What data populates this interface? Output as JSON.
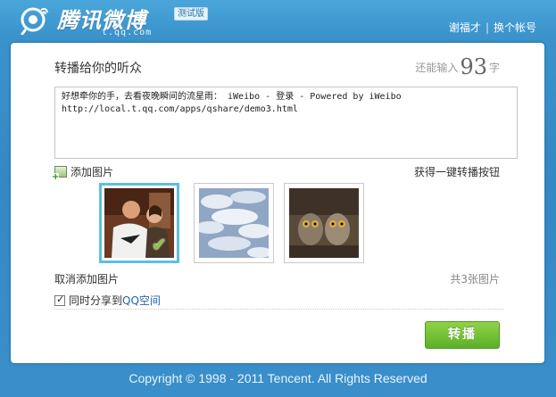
{
  "header": {
    "logo_text": "腾讯微博",
    "logo_sub": "t.qq.com",
    "logo_badge": "测试版",
    "user_name": "谢福才",
    "switch_account": "换个帐号",
    "separator": "|"
  },
  "composer": {
    "heading": "转播给你的听众",
    "counter_prefix": "还能输入",
    "counter_value": "93",
    "counter_suffix": "字",
    "text": "好想牵你的手，去看夜晚瞬间的流星雨： iWeibo - 登录 - Powered by iWeibo\nhttp://local.t.qq.com/apps/qshare/demo3.html"
  },
  "images": {
    "add_label": "添加图片",
    "get_button_link": "获得一键转播按钮",
    "cancel_label": "取消添加图片",
    "count_label": "共3张图片",
    "items": [
      {
        "subject": "two-people-photo",
        "selected": true
      },
      {
        "subject": "cloudy-sky-photo",
        "selected": false
      },
      {
        "subject": "owls-photo",
        "selected": false
      }
    ]
  },
  "share": {
    "prefix": "同时分享到",
    "target": "QQ空间",
    "checked": true
  },
  "submit_label": "转播",
  "footer": "Copyright © 1998 - 2011 Tencent. All Rights Reserved",
  "colors": {
    "background": "#3a8fca",
    "accent_green": "#6bbd2f",
    "selected_border": "#5cbfe6",
    "link_blue": "#1f65a8"
  }
}
